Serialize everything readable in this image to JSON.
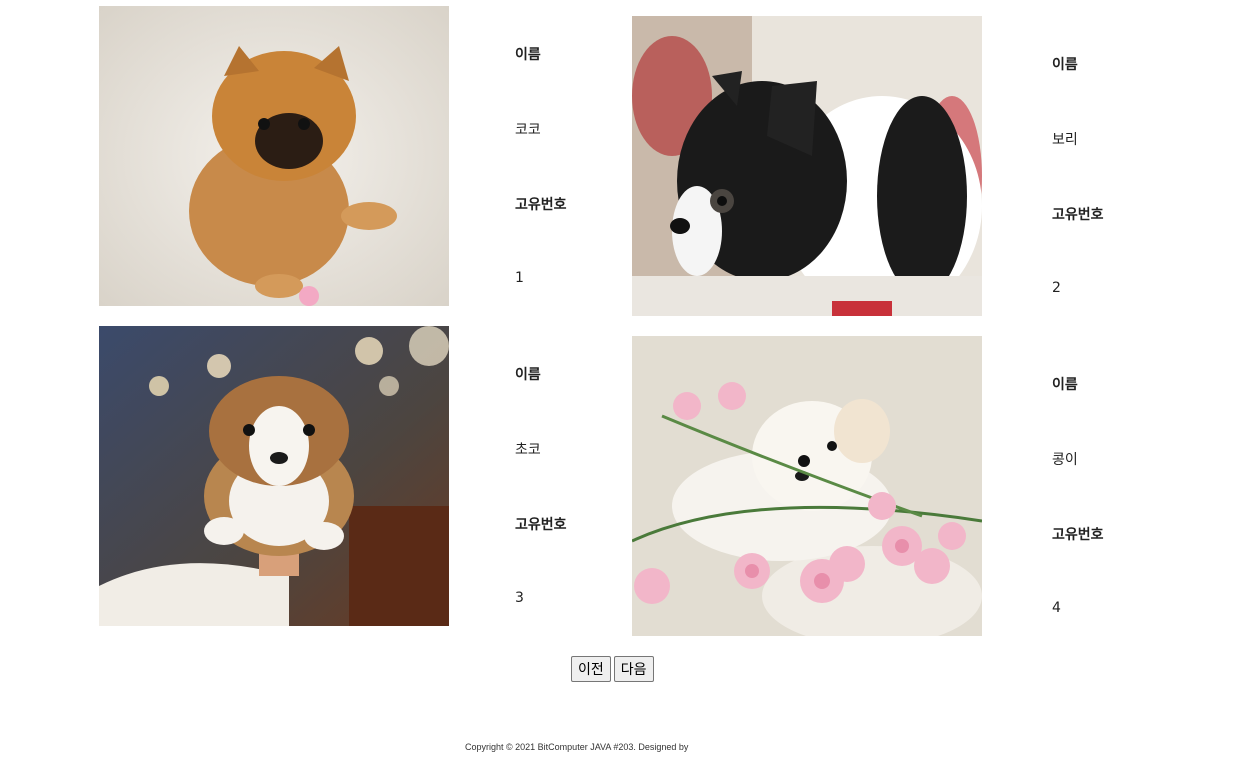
{
  "dogs": [
    {
      "name_label": "이름",
      "name": "코코",
      "id_label": "고유번호",
      "id": "1",
      "photo": "pomeranian-puppy-photo"
    },
    {
      "name_label": "이름",
      "name": "보리",
      "id_label": "고유번호",
      "id": "2",
      "photo": "boston-terrier-puppy-photo"
    },
    {
      "name_label": "이름",
      "name": "초코",
      "id_label": "고유번호",
      "id": "3",
      "photo": "corgi-puppy-photo"
    },
    {
      "name_label": "이름",
      "name": "콩이",
      "id_label": "고유번호",
      "id": "4",
      "photo": "maltese-puppy-photo"
    }
  ],
  "pager": {
    "prev_label": "이전",
    "next_label": "다음"
  },
  "footer": {
    "copyright": "Copyright © 2021 BitComputer JAVA #203. Designed by"
  }
}
